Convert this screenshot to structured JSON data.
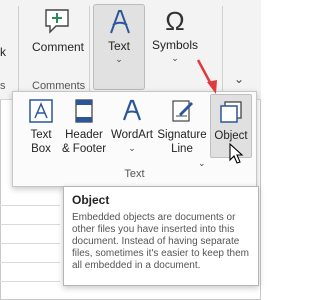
{
  "ribbon": {
    "left_edge_top": "k",
    "left_edge_bottom": "s",
    "comment": {
      "label": "Comment"
    },
    "comments_group_label": "Comments",
    "text": {
      "label": "Text",
      "chevron": "⌄"
    },
    "symbols": {
      "label": "Symbols",
      "chevron": "⌄",
      "symbol": "Ω"
    },
    "collapse_chevron": "⌄"
  },
  "text_dropdown": {
    "group_label": "Text",
    "items": [
      {
        "label": "Text\nBox"
      },
      {
        "label": "Header\n& Footer"
      },
      {
        "label": "WordArt",
        "chevron": "⌄"
      },
      {
        "label": "Signature\nLine",
        "chevron": "⌄"
      },
      {
        "label": "Object"
      }
    ]
  },
  "tooltip": {
    "title": "Object",
    "body": "Embedded objects are documents or other files you have inserted into this document. Instead of having separate files, sometimes it's easier to keep them all embedded in a document."
  },
  "colors": {
    "accent_blue": "#2b579a",
    "annotation_red": "#e03a3e",
    "ribbon_bg": "#f3f3f3",
    "selected_bg": "#e1e1e1"
  },
  "icons": [
    "comment-icon",
    "text-a-icon",
    "omega-icon",
    "text-box-icon",
    "header-footer-icon",
    "wordart-icon",
    "signature-line-icon",
    "object-icon",
    "cursor-icon",
    "annotation-arrow"
  ]
}
